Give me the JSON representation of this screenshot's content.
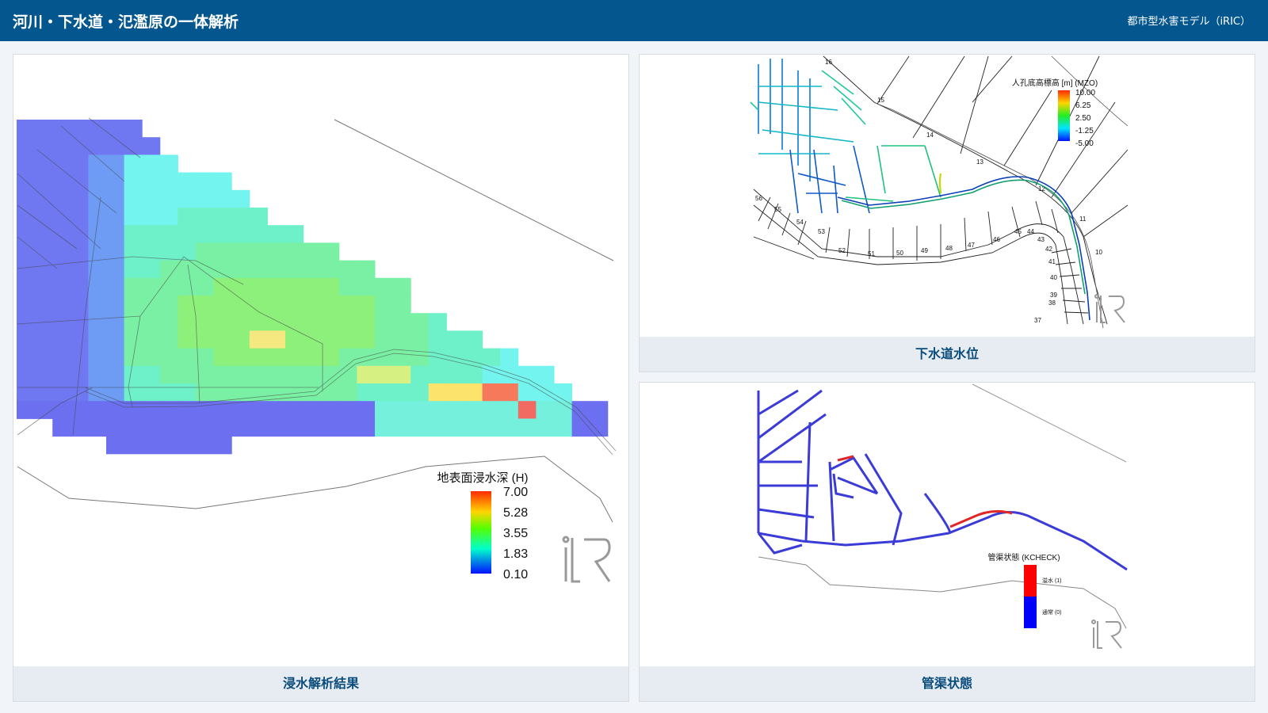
{
  "header": {
    "title": "河川・下水道・氾濫原の一体解析",
    "subtitle": "都市型水害モデル（iRIC）"
  },
  "panels": {
    "flood": {
      "caption": "浸水解析結果",
      "legend": {
        "title": "地表面浸水深 (H)",
        "ticks": [
          "7.00",
          "5.28",
          "3.55",
          "1.83",
          "0.10"
        ]
      }
    },
    "sewer": {
      "caption": "下水道水位",
      "legend": {
        "title": "人孔底高標高 [m] (MZO)",
        "ticks": [
          "10.00",
          "6.25",
          "2.50",
          "-1.25",
          "-5.00"
        ]
      },
      "section_labels": [
        "16",
        "15",
        "14",
        "13",
        "12",
        "11",
        "10",
        "56",
        "55",
        "54",
        "53",
        "52",
        "51",
        "50",
        "49",
        "48",
        "47",
        "46",
        "45",
        "44",
        "43",
        "42",
        "41",
        "40",
        "39",
        "38",
        "37"
      ]
    },
    "pipe": {
      "caption": "管渠状態",
      "legend": {
        "title": "管渠状態 (KCHECK)",
        "items": [
          "溢水 (1)",
          "通常 (0)"
        ]
      }
    }
  },
  "colors": {
    "header": "#04578e",
    "caption_bg": "#e7ecf2",
    "caption_text": "#0a4c7c"
  }
}
